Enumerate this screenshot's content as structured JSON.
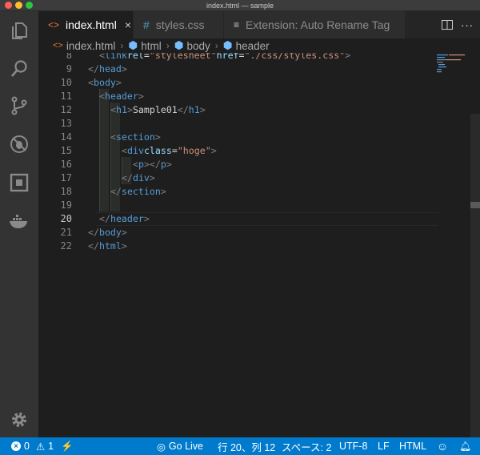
{
  "window": {
    "title": "index.html — sample"
  },
  "tabs": [
    {
      "label": "index.html",
      "icon": "html-file-icon",
      "active": true,
      "close": "×"
    },
    {
      "label": "styles.css",
      "icon": "css-file-icon",
      "active": false
    },
    {
      "label": "Extension: Auto Rename Tag",
      "icon": "extension-preview-icon",
      "active": false
    }
  ],
  "tab_actions": {
    "more": "···"
  },
  "breadcrumb": [
    "index.html",
    "html",
    "body",
    "header"
  ],
  "editor": {
    "lines": [
      {
        "n": "8",
        "text": "<link rel=\"stylesheet\" href=\"./css/styles.css\">"
      },
      {
        "n": "9",
        "text": "</head>"
      },
      {
        "n": "10",
        "text": "<body>"
      },
      {
        "n": "11",
        "text": "<header>"
      },
      {
        "n": "12",
        "text": "<h1>Sample01</h1>"
      },
      {
        "n": "13",
        "text": ""
      },
      {
        "n": "14",
        "text": "<section>"
      },
      {
        "n": "15",
        "text": "<div class=\"hoge\">"
      },
      {
        "n": "16",
        "text": "<p></p>"
      },
      {
        "n": "17",
        "text": "</div>"
      },
      {
        "n": "18",
        "text": "</section>"
      },
      {
        "n": "19",
        "text": ""
      },
      {
        "n": "20",
        "text": "</header>"
      },
      {
        "n": "21",
        "text": "</body>"
      },
      {
        "n": "22",
        "text": "</html>"
      }
    ],
    "current_line": "20"
  },
  "statusbar": {
    "errors": "0",
    "warnings": "1",
    "live": "Go Live",
    "position": "行 20、列 12",
    "spaces": "スペース: 2",
    "encoding": "UTF-8",
    "eol": "LF",
    "language": "HTML"
  },
  "colors": {
    "statusbar": "#007acc",
    "activity": "#333333",
    "editor_bg": "#1e1e1e",
    "tag": "#569cd6",
    "attr": "#9cdcfe",
    "string": "#ce9178"
  }
}
